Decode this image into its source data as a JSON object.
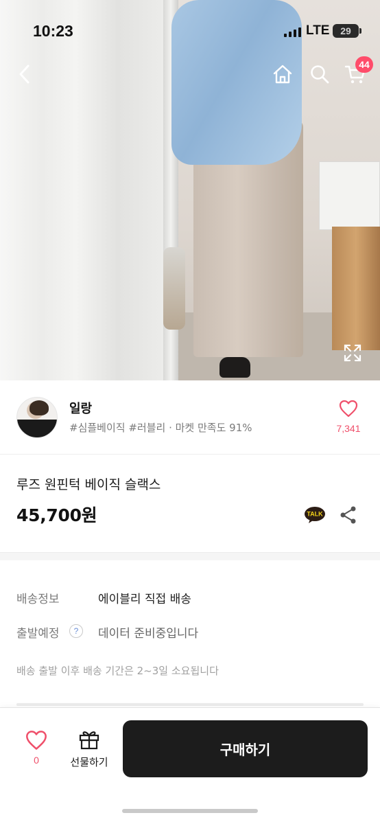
{
  "status_bar": {
    "time": "10:23",
    "network": "LTE",
    "battery": "29"
  },
  "top_nav": {
    "cart_count": "44"
  },
  "seller": {
    "name": "일랑",
    "tags": "#심플베이직 #러블리 · 마켓 만족도 91%",
    "like_count": "7,341"
  },
  "product": {
    "title": "루즈 원핀턱 베이직 슬랙스",
    "price": "45,700원",
    "talk_label": "TALK"
  },
  "shipping": {
    "info_label": "배송정보",
    "info_value": "에이블리 직접 배송",
    "depart_label": "출발예정",
    "help_mark": "?",
    "depart_value": "데이터 준비중입니다",
    "note": "배송 출발 이후 배송 기간은 2~3일 소요됩니다"
  },
  "bottom_bar": {
    "fav_count": "0",
    "gift_label": "선물하기",
    "buy_label": "구매하기"
  },
  "colors": {
    "accent_pink": "#ef4f6a",
    "badge_pink": "#ff4c6a",
    "buy_button": "#1c1c1c"
  }
}
